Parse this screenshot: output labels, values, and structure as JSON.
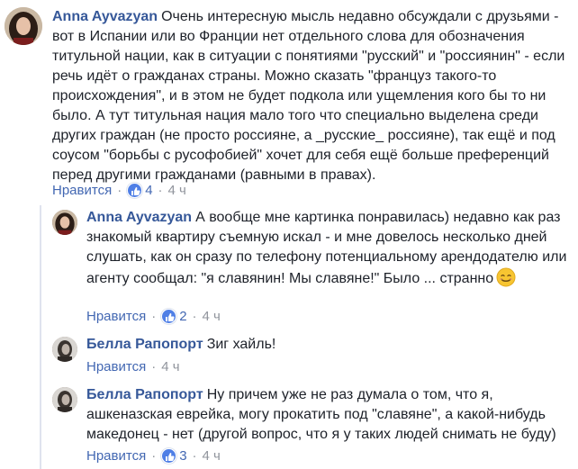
{
  "comments": [
    {
      "author": "Anna Ayvazyan",
      "text": "Очень интересную мысль недавно обсуждали с друзьями - вот в Испании или во Франции нет отдельного слова для обозначения титульной нации, как в ситуации с понятиями \"русский\" и \"россиянин\" - если речь идёт о гражданах страны. Можно сказать \"француз такого-то происхождения\", и в этом не будет подкола или ущемления кого бы то ни было. А тут титульная нация мало того что специально выделена среди других граждан (не просто россияне, а _русские_ россияне), так ещё и под соусом \"борьбы с русофобией\" хочет для себя ещё больше преференций перед другими гражданами (равными в правах).",
      "like_label": "Нравится",
      "separator": "·",
      "like_count": "4",
      "time": "4 ч"
    },
    {
      "author": "Anna Ayvazyan",
      "text": "А вообще мне картинка понравилась) недавно как раз знакомый квартиру съемную искал - и мне довелось несколько дней слушать, как он сразу по телефону потенциальному арендодателю или агенту сообщал: \"я славянин! Мы славяне!\" Было ... странно",
      "like_label": "Нравится",
      "separator": "·",
      "like_count": "2",
      "time": "4 ч"
    },
    {
      "author": "Белла Рапопорт",
      "text": "Зиг хайль!",
      "like_label": "Нравится",
      "separator": "·",
      "time": "4 ч"
    },
    {
      "author": "Белла Рапопорт",
      "text": "Ну причем уже не раз думала о том, что я, ашкеназская еврейка, могу прокатить под \"славяне\", а какой-нибудь македонец - нет (другой вопрос, что я у таких людей снимать не буду)",
      "like_label": "Нравится",
      "separator": "·",
      "like_count": "3",
      "time": "4 ч"
    }
  ],
  "icons": {
    "like_reaction": "thumbs-up-icon",
    "emoji": "smiling-face-icon"
  },
  "colors": {
    "author": "#365899",
    "link": "#4267b2",
    "meta": "#90949c",
    "like_badge": "#4f7fe6"
  }
}
